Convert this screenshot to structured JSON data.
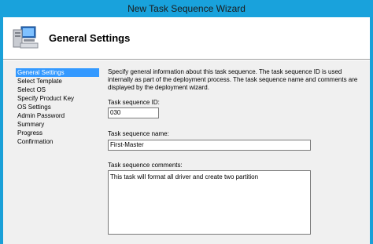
{
  "window": {
    "title": "New Task Sequence Wizard"
  },
  "header": {
    "title": "General Settings",
    "icon": "computer-icon"
  },
  "nav": {
    "items": [
      {
        "label": "General Settings",
        "active": true
      },
      {
        "label": "Select Template",
        "active": false
      },
      {
        "label": "Select OS",
        "active": false
      },
      {
        "label": "Specify Product Key",
        "active": false
      },
      {
        "label": "OS Settings",
        "active": false
      },
      {
        "label": "Admin Password",
        "active": false
      },
      {
        "label": "Summary",
        "active": false
      },
      {
        "label": "Progress",
        "active": false
      },
      {
        "label": "Confirmation",
        "active": false
      }
    ]
  },
  "content": {
    "description": "Specify general information about this task sequence.  The task sequence ID is used internally as part of the deployment process.  The task sequence name and comments are displayed by the deployment wizard.",
    "id_label": "Task sequence ID:",
    "id_value": "030",
    "name_label": "Task sequence name:",
    "name_value": "First-Master",
    "comments_label": "Task sequence comments:",
    "comments_value": "This task will format all driver and create two partition"
  },
  "colors": {
    "title_bar": "#19a2dc",
    "selection": "#3399ff"
  }
}
